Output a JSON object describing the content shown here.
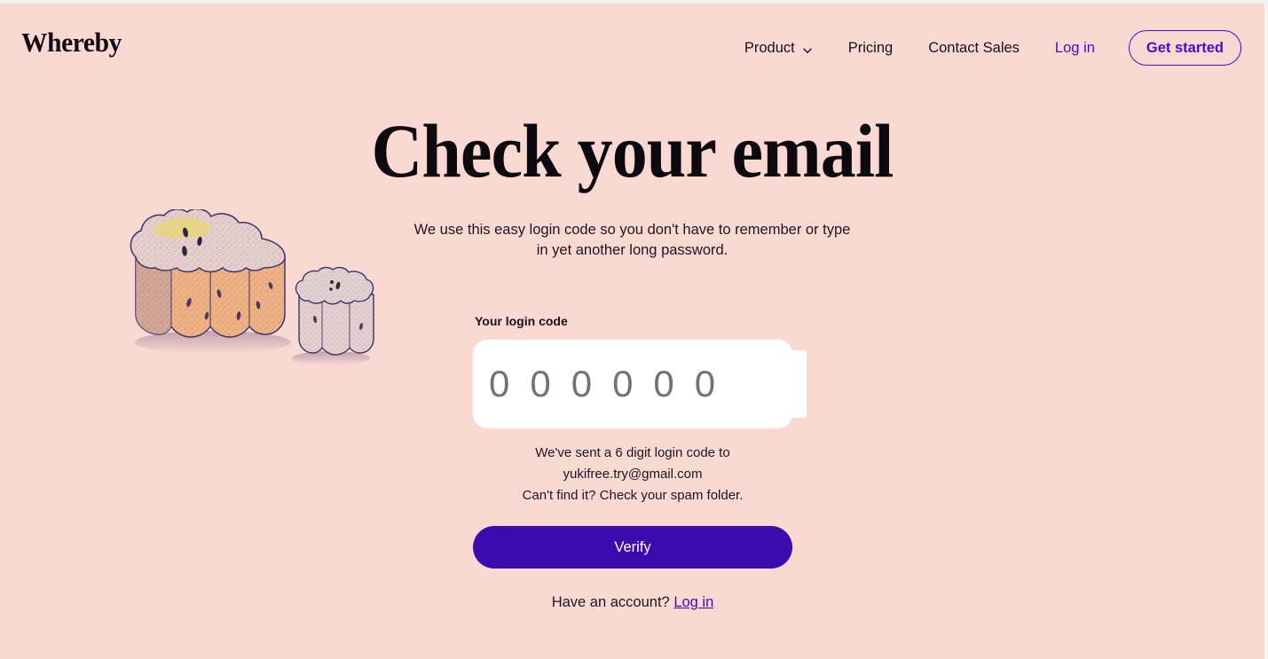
{
  "theme": {
    "page_bg": "#FBD9D3",
    "accent_purple": "#4C0BC6",
    "button_purple": "#3C0BAE",
    "text_dark": "#16121B",
    "placeholder_grey": "#737373",
    "card_white": "#FFFFFF"
  },
  "header": {
    "logo_text": "Whereby",
    "nav": [
      {
        "label": "Product",
        "icon": "chevron-down-icon",
        "has_dropdown": true,
        "style": "dark"
      },
      {
        "label": "Pricing",
        "has_dropdown": false,
        "style": "dark"
      },
      {
        "label": "Contact Sales",
        "has_dropdown": false,
        "style": "dark"
      },
      {
        "label": "Log in",
        "has_dropdown": false,
        "style": "purple"
      }
    ],
    "cta_label": "Get started"
  },
  "hero": {
    "title": "Check your email",
    "subtitle": "We use this easy login code so you don't have to remember or type in yet another long password."
  },
  "illustration": {
    "name": "panettone-cakes-illustration",
    "description": "Two cloud-shaped speckled cakes, large orange one and small cream one, hand-drawn ink outline"
  },
  "form": {
    "field_label": "Your login code",
    "code_value": "",
    "code_placeholder": "000000",
    "code_digits": 6,
    "sent_line_1": "We've sent a 6 digit login code to",
    "sent_email": "yukifree.try@gmail.com",
    "sent_line_3": "Can't find it? Check your spam folder.",
    "verify_label": "Verify",
    "footer_prefix": "Have an account?",
    "footer_link": "Log in"
  }
}
